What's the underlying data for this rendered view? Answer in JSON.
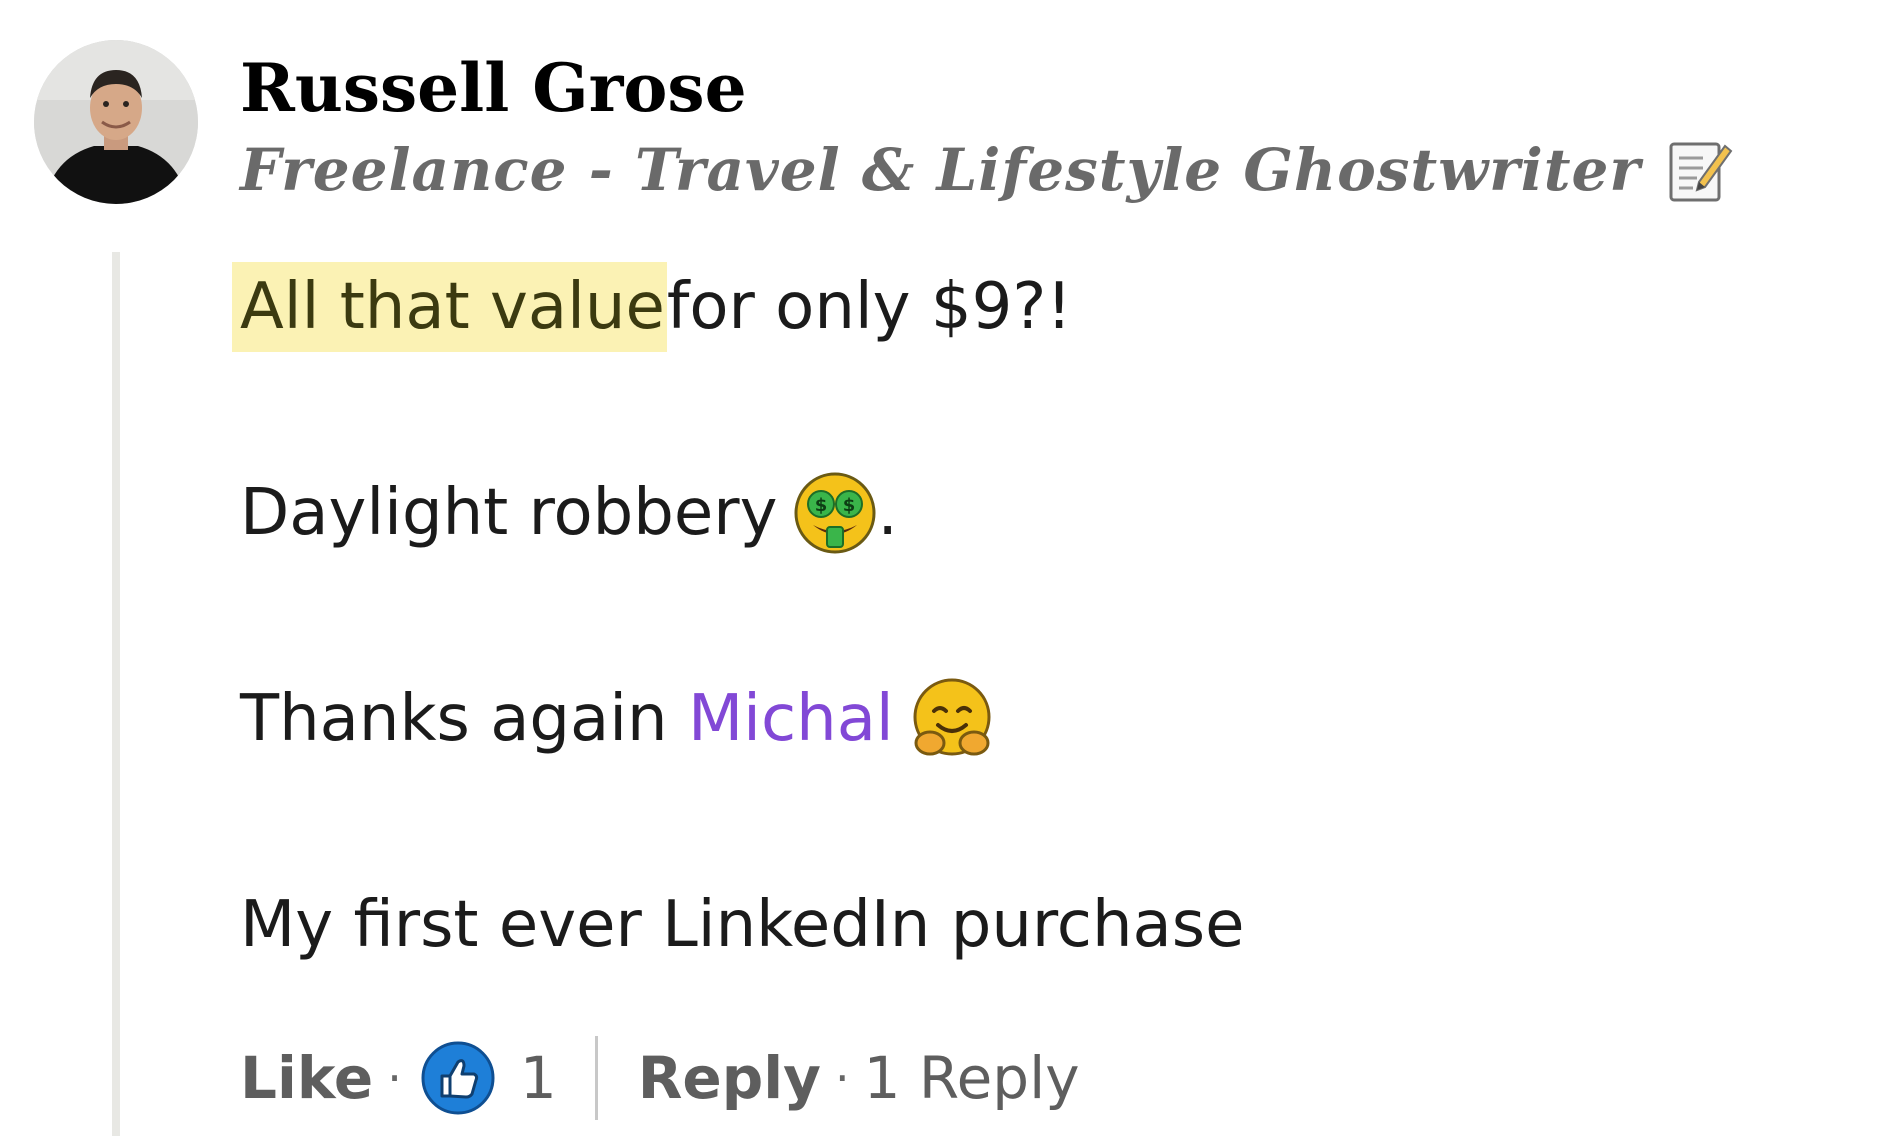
{
  "author": {
    "name": "Russell Grose",
    "headline": "Freelance - Travel & Lifestyle Ghostwriter",
    "headline_icon": "memo-icon"
  },
  "comment": {
    "highlighted_text": "All that value ",
    "line1_rest": "for only $9?!",
    "line2": "Daylight robbery",
    "line2_emoji": "money-mouth-face-icon",
    "line2_end": ".",
    "line3_prefix": "Thanks again",
    "mention": "Michal",
    "line3_emoji": "hugging-face-icon",
    "line4": "My first ever LinkedIn purchase"
  },
  "actions": {
    "like_label": "Like",
    "separator": "·",
    "reaction_icon": "thumbs-up-icon",
    "reaction_count": "1",
    "reply_label": "Reply",
    "replies_count_label": "1 Reply"
  },
  "colors": {
    "highlight": "#fbf2b4",
    "mention": "#8248d6",
    "like_blue": "#1e7fd8",
    "thread_line": "#e8e8e4"
  }
}
